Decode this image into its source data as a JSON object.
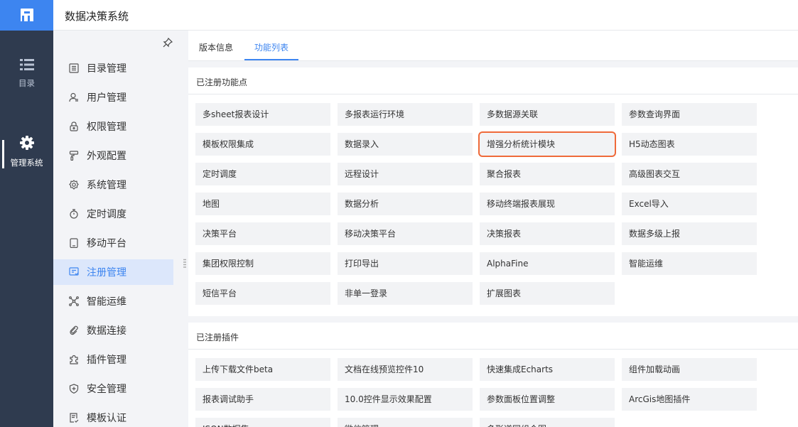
{
  "app": {
    "title": "数据决策系统"
  },
  "rail": {
    "items": [
      {
        "label": "目录",
        "icon": "list-icon"
      },
      {
        "label": "管理系统",
        "icon": "gear-icon"
      }
    ]
  },
  "submenu": {
    "items": [
      {
        "label": "目录管理",
        "icon": "catalog-icon"
      },
      {
        "label": "用户管理",
        "icon": "user-icon"
      },
      {
        "label": "权限管理",
        "icon": "lock-icon"
      },
      {
        "label": "外观配置",
        "icon": "brush-icon"
      },
      {
        "label": "系统管理",
        "icon": "settings-icon"
      },
      {
        "label": "定时调度",
        "icon": "timer-icon"
      },
      {
        "label": "移动平台",
        "icon": "tablet-icon"
      },
      {
        "label": "注册管理",
        "icon": "register-icon"
      },
      {
        "label": "智能运维",
        "icon": "network-icon"
      },
      {
        "label": "数据连接",
        "icon": "link-icon"
      },
      {
        "label": "插件管理",
        "icon": "plugin-icon"
      },
      {
        "label": "安全管理",
        "icon": "shield-icon"
      },
      {
        "label": "模板认证",
        "icon": "template-icon"
      }
    ],
    "active": "注册管理"
  },
  "tabs": [
    {
      "label": "版本信息"
    },
    {
      "label": "功能列表"
    }
  ],
  "active_tab": "功能列表",
  "features": {
    "title": "已注册功能点",
    "items": [
      "多sheet报表设计",
      "多报表运行环境",
      "多数据源关联",
      "参数查询界面",
      "模板权限集成",
      "数据录入",
      "增强分析统计模块",
      "H5动态图表",
      "定时调度",
      "远程设计",
      "聚合报表",
      "高级图表交互",
      "地图",
      "数据分析",
      "移动终端报表展现",
      "Excel导入",
      "决策平台",
      "移动决策平台",
      "决策报表",
      "数据多级上报",
      "集团权限控制",
      "打印导出",
      "AlphaFine",
      "智能运维",
      "短信平台",
      "非单一登录",
      "扩展图表"
    ],
    "highlighted": "增强分析统计模块"
  },
  "plugins": {
    "title": "已注册插件",
    "items": [
      "上传下载文件beta",
      "文档在线预览控件10",
      "快速集成Echarts",
      "组件加载动画",
      "报表调试助手",
      "10.0控件显示效果配置",
      "参数面板位置调整",
      "ArcGis地图插件",
      "JSON数据集",
      "微信管理",
      "多形道同组合图"
    ]
  },
  "colors": {
    "accent": "#3d85f0",
    "rail": "#2f3b4f",
    "highlight": "#ef6a3a"
  }
}
